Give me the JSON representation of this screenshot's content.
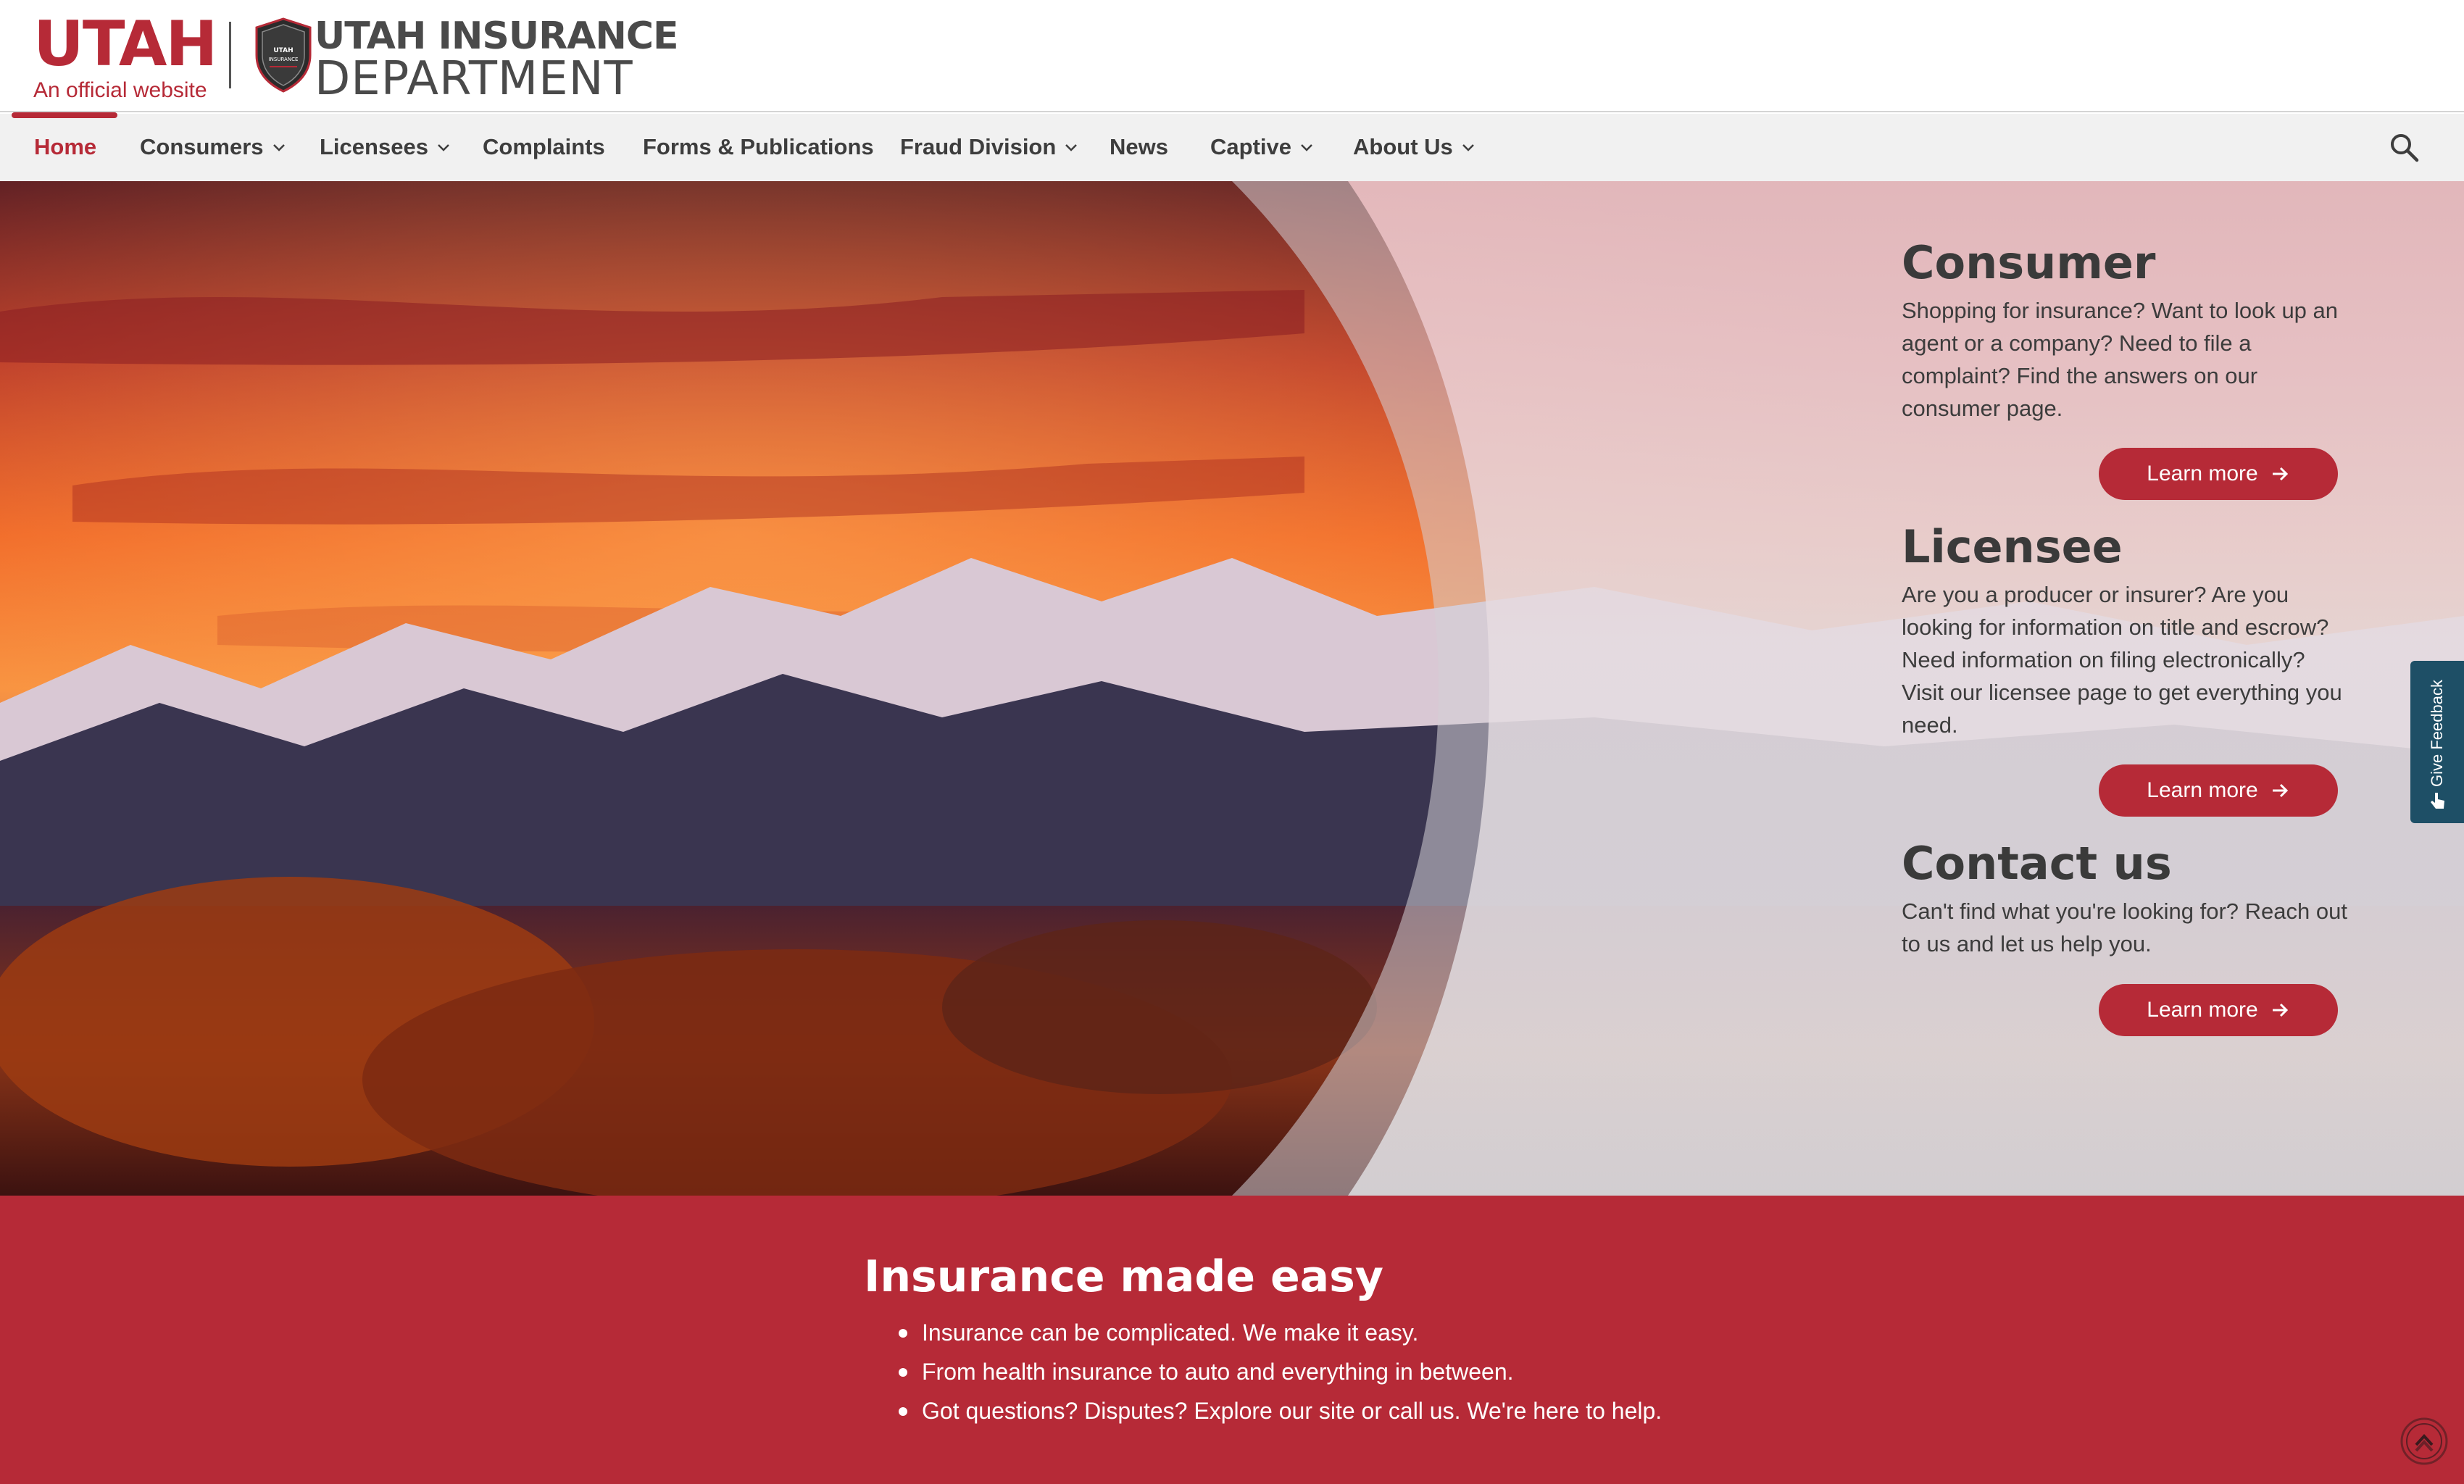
{
  "brand": {
    "utah": "UTAH",
    "official": "An official website",
    "dept_line1": "UTAH INSURANCE",
    "dept_line2": "DEPARTMENT",
    "badge_text_1": "UTAH",
    "badge_text_2": "INSURANCE",
    "accent": "#b62a37",
    "dark_teal": "#1e4f66"
  },
  "nav": {
    "items": [
      {
        "label": "Home",
        "active": true,
        "dropdown": false
      },
      {
        "label": "Consumers",
        "active": false,
        "dropdown": true
      },
      {
        "label": "Licensees",
        "active": false,
        "dropdown": true
      },
      {
        "label": "Complaints",
        "active": false,
        "dropdown": false
      },
      {
        "label": "Forms & Publications",
        "active": false,
        "dropdown": false
      },
      {
        "label": "Fraud Division",
        "active": false,
        "dropdown": true
      },
      {
        "label": "News",
        "active": false,
        "dropdown": false
      },
      {
        "label": "Captive",
        "active": false,
        "dropdown": true
      },
      {
        "label": "About Us",
        "active": false,
        "dropdown": true
      }
    ],
    "search_icon": "search-icon"
  },
  "hero": {
    "cards": [
      {
        "title": "Consumer",
        "text": "Shopping for insurance? Want to look up an agent or a company? Need to file a complaint? Find the answers on our consumer page.",
        "button": "Learn more"
      },
      {
        "title": "Licensee",
        "text": "Are you a producer or insurer? Are you looking for information on title and escrow? Need information on filing electronically? Visit our licensee page to get everything you need.",
        "button": "Learn more"
      },
      {
        "title": "Contact us",
        "text": "Can't find what you're looking for? Reach out to us and let us help you.",
        "button": "Learn more"
      }
    ]
  },
  "feedback": {
    "label": "Give Feedback"
  },
  "band": {
    "title": "Insurance made easy",
    "bullets": [
      "Insurance can be complicated. We make it easy.",
      "From health insurance to auto and everything in between.",
      "Got questions? Disputes? Explore our site or call us. We're here to help."
    ]
  }
}
